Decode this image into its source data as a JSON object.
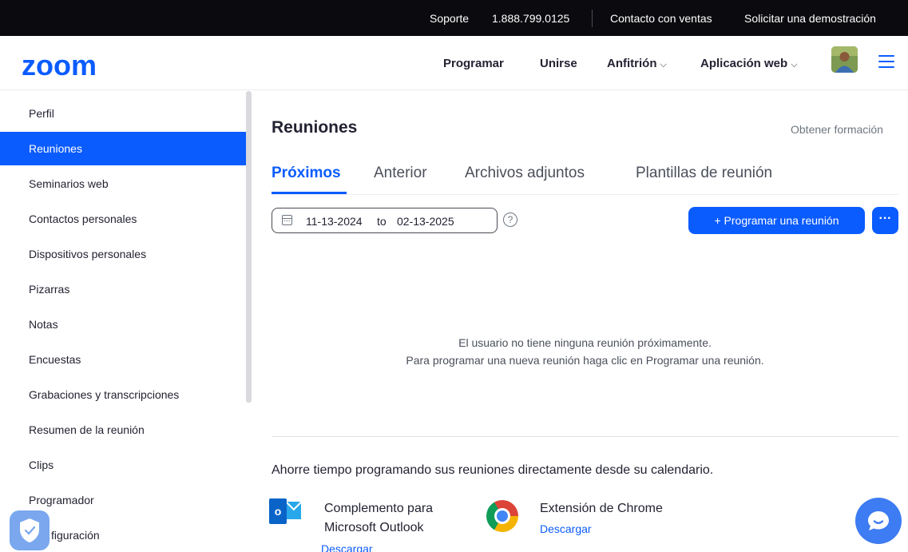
{
  "topbar": {
    "support": "Soporte",
    "phone": "1.888.799.0125",
    "contact_sales": "Contacto con ventas",
    "request_demo": "Solicitar una demostración"
  },
  "header": {
    "logo": "zoom",
    "nav": {
      "schedule": "Programar",
      "join": "Unirse",
      "host": "Anfitrión",
      "web_app": "Aplicación web"
    }
  },
  "sidebar": {
    "items": [
      {
        "label": "Perfil"
      },
      {
        "label": "Reuniones"
      },
      {
        "label": "Seminarios web"
      },
      {
        "label": "Contactos personales"
      },
      {
        "label": "Dispositivos personales"
      },
      {
        "label": "Pizarras"
      },
      {
        "label": "Notas"
      },
      {
        "label": "Encuestas"
      },
      {
        "label": "Grabaciones y transcripciones"
      },
      {
        "label": "Resumen de la reunión"
      },
      {
        "label": "Clips"
      },
      {
        "label": "Programador"
      },
      {
        "label": "figuración"
      }
    ],
    "active_index": 1
  },
  "main": {
    "title": "Reuniones",
    "training_link": "Obtener formación",
    "tabs": [
      {
        "label": "Próximos",
        "active": true
      },
      {
        "label": "Anterior",
        "active": false
      },
      {
        "label": "Archivos adjuntos",
        "active": false
      },
      {
        "label": "Plantillas de reunión",
        "active": false
      }
    ],
    "date_range": {
      "from": "11-13-2024",
      "to_word": "to",
      "to": "02-13-2025"
    },
    "help_glyph": "?",
    "schedule_button": "+  Programar una reunión",
    "more_button": "···",
    "empty_line1": "El usuario no tiene ninguna reunión próximamente.",
    "empty_line2": "Para programar una nueva reunión haga clic en Programar una reunión.",
    "calendar_promo": "Ahorre tiempo programando sus reuniones directamente desde su calendario.",
    "outlook": {
      "line1": "Complemento para",
      "line2": "Microsoft Outlook",
      "link": "Descargar"
    },
    "chrome": {
      "title": "Extensión de Chrome",
      "link": "Descargar"
    }
  },
  "colors": {
    "brand_blue": "#0b5cff",
    "topbar_bg": "#0b0b0f"
  },
  "icons": [
    "chevron-down-icon",
    "hamburger-menu-icon",
    "calendar-icon",
    "help-icon",
    "outlook-icon",
    "chrome-icon",
    "shield-icon",
    "chat-icon"
  ]
}
